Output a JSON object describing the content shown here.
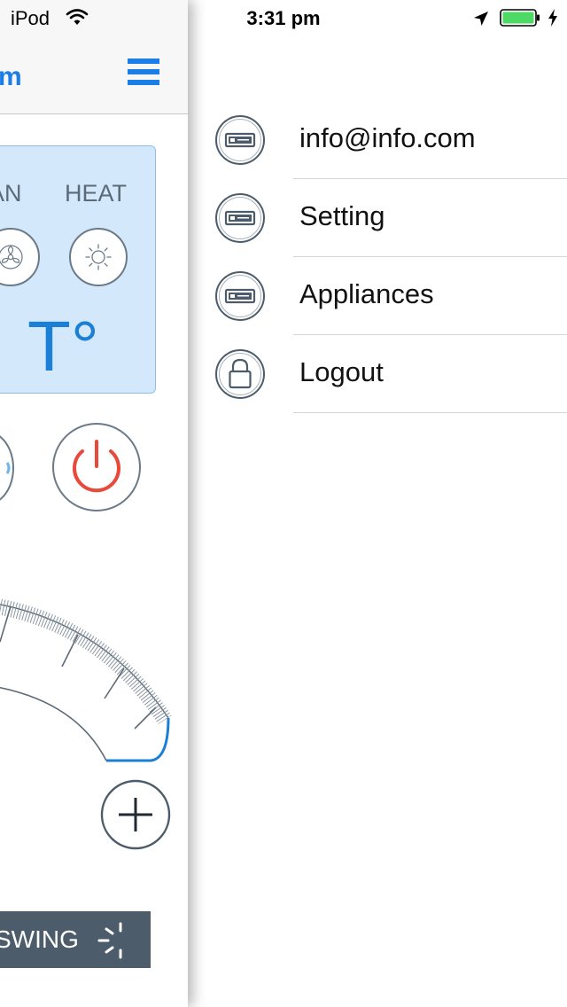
{
  "status_bar": {
    "carrier": "iPod",
    "time": "3:31 pm",
    "icons": [
      "wifi-icon",
      "location-arrow-icon",
      "battery-icon",
      "charging-bolt-icon"
    ]
  },
  "main_screen": {
    "nav_title_fragment": "m",
    "menu_button_icon": "hamburger-menu-icon",
    "modes": [
      {
        "label": "AN",
        "icon": "fan-icon"
      },
      {
        "label": "HEAT",
        "icon": "sun-icon"
      }
    ],
    "temperature": "T°",
    "power_icon": "power-icon",
    "increase_icon": "plus-icon",
    "swing": {
      "label": "SWING",
      "icon": "swing-icon"
    }
  },
  "side_menu": {
    "items": [
      {
        "label": "info@info.com",
        "icon": "remote-icon"
      },
      {
        "label": "Setting",
        "icon": "remote-icon"
      },
      {
        "label": "Appliances",
        "icon": "remote-icon"
      },
      {
        "label": "Logout",
        "icon": "lock-icon"
      }
    ]
  },
  "colors": {
    "accent_blue": "#1a7ee6",
    "mode_panel_bg": "#d3e9fb",
    "power_red": "#e8493a",
    "swing_bg": "#4d5c6a",
    "icon_stroke": "#4d5c6a"
  }
}
